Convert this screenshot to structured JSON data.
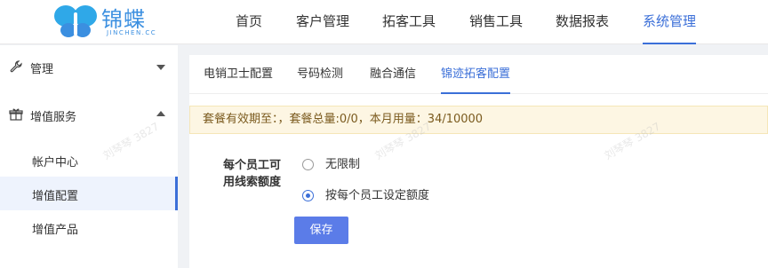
{
  "header": {
    "logo": {
      "text": "锦蝶",
      "subtext": "JINCHEN.CC"
    },
    "nav": [
      {
        "label": "首页"
      },
      {
        "label": "客户管理"
      },
      {
        "label": "拓客工具"
      },
      {
        "label": "销售工具"
      },
      {
        "label": "数据报表"
      },
      {
        "label": "系统管理",
        "active": true
      }
    ]
  },
  "sidebar": {
    "groups": [
      {
        "label": "管理",
        "icon": "wrench-icon",
        "expanded": false
      },
      {
        "label": "增值服务",
        "icon": "gift-icon",
        "expanded": true,
        "items": [
          {
            "label": "帐户中心"
          },
          {
            "label": "增值配置",
            "active": true
          },
          {
            "label": "增值产品"
          }
        ]
      }
    ]
  },
  "content": {
    "tabs": [
      {
        "label": "电销卫士配置"
      },
      {
        "label": "号码检测"
      },
      {
        "label": "融合通信"
      },
      {
        "label": "锦迹拓客配置",
        "active": true
      }
    ],
    "notice": "套餐有效期至：，套餐总量:0/0，本月用量：34/10000",
    "form": {
      "label_line1": "每个员工可",
      "label_line2": "用线索额度",
      "options": [
        {
          "label": "无限制",
          "checked": false
        },
        {
          "label": "按每个员工设定额度",
          "checked": true
        }
      ],
      "save_label": "保存"
    }
  },
  "watermark": "刘琴琴 3827",
  "colors": {
    "accent": "#3b6fd8",
    "button": "#5b7ce8",
    "notice_bg": "#fdf6e3"
  }
}
